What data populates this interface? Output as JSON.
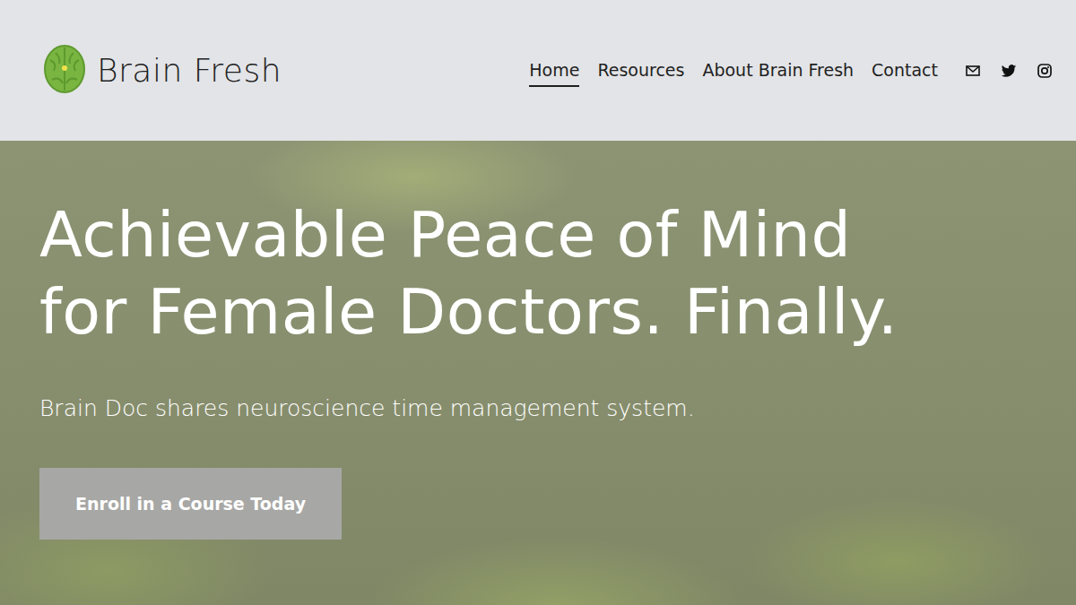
{
  "brand": {
    "name": "Brain Fresh"
  },
  "nav": [
    {
      "label": "Home",
      "selected": true
    },
    {
      "label": "Resources",
      "selected": false
    },
    {
      "label": "About Brain Fresh",
      "selected": false
    },
    {
      "label": "Contact",
      "selected": false
    }
  ],
  "hero": {
    "headline": [
      "Achievable Peace of Mind",
      "for Female Doctors. Finally."
    ],
    "subtitle": "Brain Doc shares neuroscience time management system.",
    "button": "Enroll in a Course Today"
  }
}
